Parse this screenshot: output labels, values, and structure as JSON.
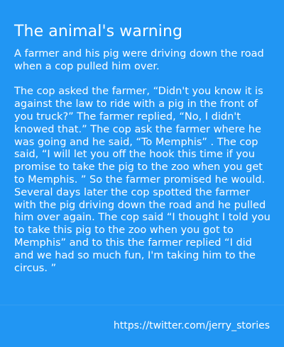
{
  "card": {
    "title": "The animal's warning",
    "paragraphs": [
      "A farmer and his pig were driving down the road when a cop pulled him over.",
      "The cop asked the farmer, “Didn't you know it is against the law to ride with a pig in the front of you truck?” The farmer replied, “No, I didn't knowed that.” The cop ask the farmer where he was going and he said, “To Memphis” . The cop said, “I will let you off the hook this time if you promise to take the pig to the zoo when you get to Memphis. ” So the farmer promised he would. Several days later the cop spotted the farmer with the pig driving down the road and he pulled him over again. The cop said “I thought I told you to take this pig to the zoo when you got to Memphis” and to this the farmer replied “I did and we had so much fun, I'm taking him to the circus. ”"
    ]
  },
  "footer": {
    "link_text": "https://twitter.com/jerry_stories"
  },
  "colors": {
    "background": "#2196f3",
    "text": "#ffffff"
  }
}
